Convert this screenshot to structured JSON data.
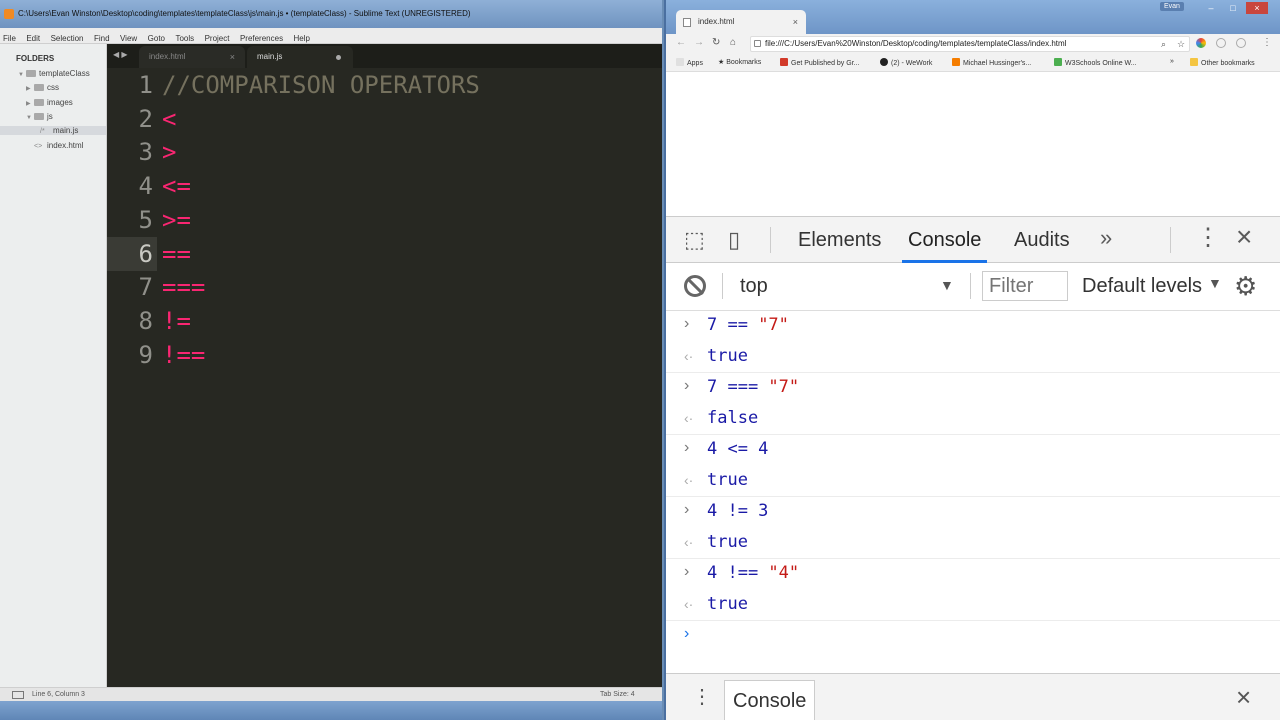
{
  "sublime": {
    "title": "C:\\Users\\Evan Winston\\Desktop\\coding\\templates\\templateClass\\js\\main.js • (templateClass) - Sublime Text (UNREGISTERED)",
    "menu": [
      "File",
      "Edit",
      "Selection",
      "Find",
      "View",
      "Goto",
      "Tools",
      "Project",
      "Preferences",
      "Help"
    ],
    "sidebar": {
      "title": "FOLDERS",
      "root": "templateClass",
      "items": [
        "css",
        "images",
        "js",
        "main.js",
        "index.html"
      ]
    },
    "tabs": {
      "inactive": "index.html",
      "active": "main.js"
    },
    "code_lines": [
      {
        "num": "1",
        "text": "//COMPARISON OPERATORS"
      },
      {
        "num": "2",
        "text": "<"
      },
      {
        "num": "3",
        "text": ">"
      },
      {
        "num": "4",
        "text": "<="
      },
      {
        "num": "5",
        "text": ">="
      },
      {
        "num": "6",
        "text": "=="
      },
      {
        "num": "7",
        "text": "==="
      },
      {
        "num": "8",
        "text": "!="
      },
      {
        "num": "9",
        "text": "!=="
      }
    ],
    "status": {
      "position": "Line 6, Column 3",
      "tab_size": "Tab Size: 4"
    }
  },
  "chrome": {
    "tab_title": "index.html",
    "user": "Evan",
    "url": "file:///C:/Users/Evan%20Winston/Desktop/coding/templates/templateClass/index.html",
    "bookmarks": [
      "Apps",
      "Bookmarks",
      "Get Published by Gr...",
      "(2) - WeWork",
      "Michael Hussinger's...",
      "W3Schools Online W...",
      "»",
      "Other bookmarks"
    ],
    "devtools": {
      "tabs": [
        "Elements",
        "Console",
        "Audits"
      ],
      "context": "top",
      "filter_placeholder": "Filter",
      "levels": "Default levels",
      "entries": [
        {
          "left": "7 == ",
          "str": "\"7\"",
          "result": "true"
        },
        {
          "left": "7 === ",
          "str": "\"7\"",
          "result": "false"
        },
        {
          "left": "4 <= 4",
          "str": "",
          "result": "true"
        },
        {
          "left": "4 != 3",
          "str": "",
          "result": "true"
        },
        {
          "left": "4 !== ",
          "str": "\"4\"",
          "result": "true"
        }
      ],
      "drawer_tab": "Console"
    }
  },
  "colors": {
    "keyword": "#f92672",
    "comment": "#75715e",
    "accent": "#1a73e8"
  }
}
